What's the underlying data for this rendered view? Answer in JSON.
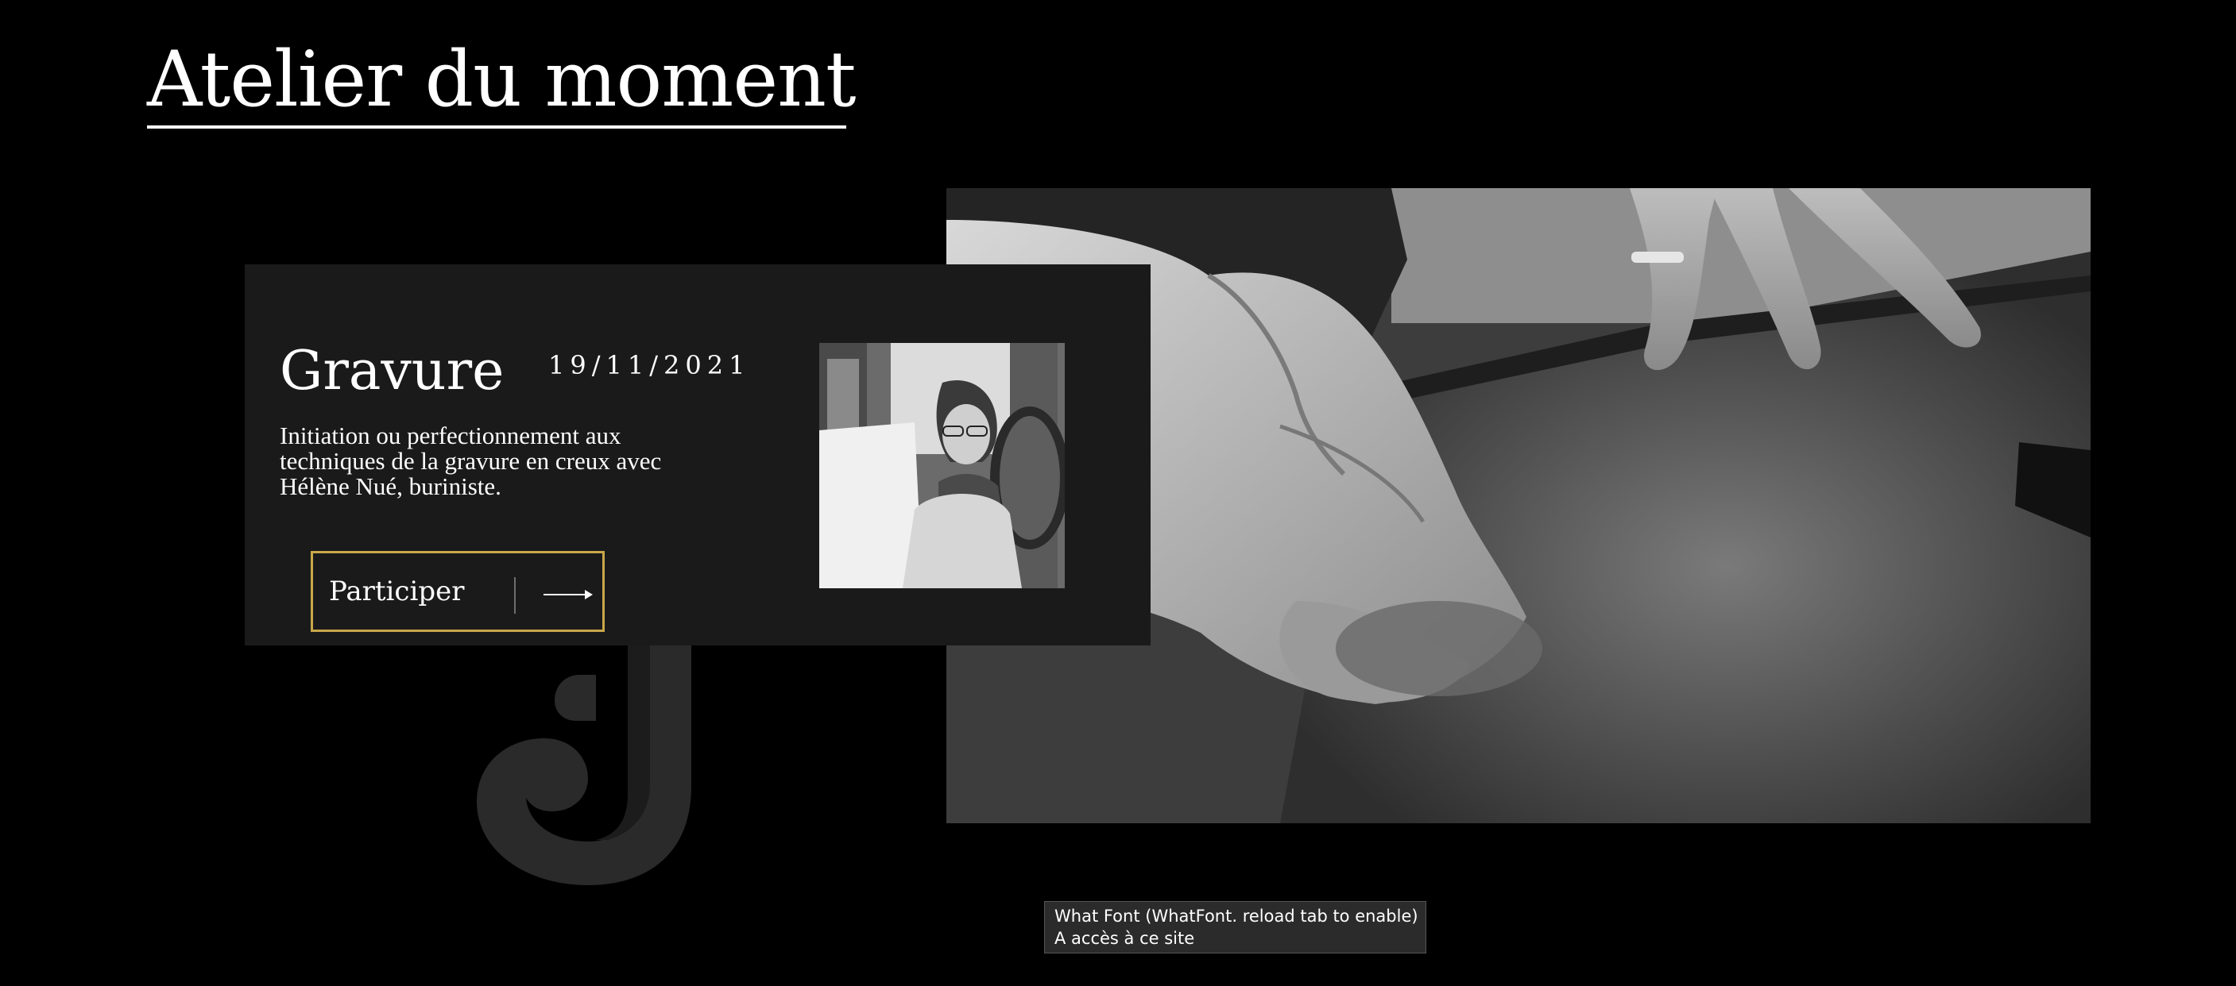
{
  "section": {
    "title": "Atelier du moment"
  },
  "workshop": {
    "title": "Gravure",
    "date": "19/11/2021",
    "description": "Initiation ou perfectionnement aux techniques de la gravure en creux avec Hélène Nué, buriniste.",
    "button_label": "Participer",
    "button_icon": "arrow-right-icon",
    "accent_color": "#c9a74a"
  },
  "logo": {
    "glyph": "J",
    "color": "#2a2a2a"
  },
  "tooltip": {
    "line1": "What Font (WhatFont. reload tab to enable)",
    "line2": "A accès à ce site"
  }
}
